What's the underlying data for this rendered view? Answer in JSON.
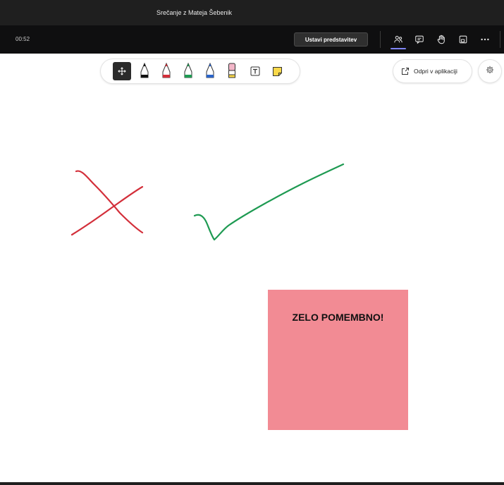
{
  "window": {
    "title": "Srečanje z Mateja Šebenik"
  },
  "meeting_bar": {
    "timer": "00:52",
    "stop_presenting_label": "Ustavi predstavitev",
    "icons": [
      "people-icon",
      "chat-icon",
      "raise-hand-icon",
      "share-tray-icon",
      "more-options-icon"
    ],
    "active_icon": "people-icon",
    "accent_color": "#7f85f5"
  },
  "whiteboard_toolbar": {
    "tools": [
      {
        "name": "pan-tool-icon",
        "active": true
      },
      {
        "name": "black-pen-icon",
        "color": "#111111"
      },
      {
        "name": "red-pen-icon",
        "color": "#d32f3a"
      },
      {
        "name": "green-pen-icon",
        "color": "#1e9a52"
      },
      {
        "name": "blue-pen-icon",
        "color": "#2a64c8"
      },
      {
        "name": "eraser-icon",
        "color": "#f2b6c8"
      },
      {
        "name": "text-tool-icon"
      },
      {
        "name": "sticky-note-icon",
        "color": "#f9d84a"
      }
    ]
  },
  "open_in_app": {
    "label": "Odpri v aplikaciji",
    "icon": "open-in-app-icon"
  },
  "settings": {
    "icon": "gear-icon"
  },
  "canvas": {
    "strokes": [
      {
        "name": "red-x-mark",
        "color": "#d32f3a"
      },
      {
        "name": "green-check-mark",
        "color": "#1e9a52"
      }
    ],
    "sticky_note": {
      "text": "ZELO POMEMBNO!",
      "color": "#f28b94"
    }
  }
}
